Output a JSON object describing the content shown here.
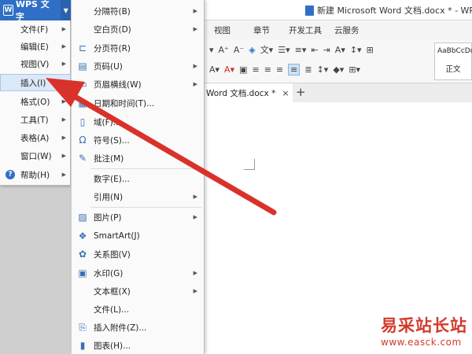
{
  "app": {
    "title_label": "WPS 文字",
    "window_title": "新建 Microsoft Word 文档.docx * - WPS 文",
    "logo_letter": "W"
  },
  "ribbon": {
    "tabs": [
      "视图",
      "章节",
      "开发工具",
      "云服务"
    ],
    "style_preview": "AaBbCcDd",
    "style_name": "正文"
  },
  "document_tab": {
    "label": "Word 文档.docx *",
    "close": "×",
    "new_tab": "+"
  },
  "main_menu": {
    "items": [
      {
        "label": "文件(F)",
        "has_submenu": true
      },
      {
        "label": "编辑(E)",
        "has_submenu": true
      },
      {
        "label": "视图(V)",
        "has_submenu": true
      },
      {
        "label": "插入(I)",
        "has_submenu": true,
        "active": true
      },
      {
        "label": "格式(O)",
        "has_submenu": true
      },
      {
        "label": "工具(T)",
        "has_submenu": true
      },
      {
        "label": "表格(A)",
        "has_submenu": true
      },
      {
        "label": "窗口(W)",
        "has_submenu": true
      },
      {
        "label": "帮助(H)",
        "has_submenu": true,
        "icon": "help-icon",
        "icon_glyph": "?"
      }
    ]
  },
  "insert_menu": {
    "items": [
      {
        "label": "分隔符(B)",
        "has_submenu": true,
        "icon": ""
      },
      {
        "label": "空白页(D)",
        "has_submenu": true,
        "icon": ""
      },
      {
        "label": "分页符(R)",
        "has_submenu": false,
        "icon": "page-break-icon"
      },
      {
        "label": "页码(U)",
        "has_submenu": true,
        "icon": "page-number-icon"
      },
      {
        "label": "页眉横线(W)",
        "has_submenu": true,
        "icon": "header-line-icon"
      },
      {
        "label": "日期和时间(T)...",
        "has_submenu": false,
        "icon": "date-time-icon"
      },
      {
        "label": "域(F)...",
        "has_submenu": false,
        "icon": "field-icon"
      },
      {
        "label": "符号(S)...",
        "has_submenu": false,
        "icon": "symbol-icon"
      },
      {
        "label": "批注(M)",
        "has_submenu": false,
        "icon": "comment-icon"
      },
      {
        "label": "数字(E)...",
        "has_submenu": false,
        "icon": ""
      },
      {
        "label": "引用(N)",
        "has_submenu": true,
        "icon": ""
      },
      {
        "label": "图片(P)",
        "has_submenu": true,
        "icon": "picture-icon"
      },
      {
        "label": "SmartArt(J)",
        "has_submenu": false,
        "icon": "smartart-icon"
      },
      {
        "label": "关系图(V)",
        "has_submenu": false,
        "icon": "relation-diagram-icon"
      },
      {
        "label": "水印(G)",
        "has_submenu": true,
        "icon": "watermark-icon"
      },
      {
        "label": "文本框(X)",
        "has_submenu": true,
        "icon": ""
      },
      {
        "label": "文件(L)...",
        "has_submenu": false,
        "icon": ""
      },
      {
        "label": "插入附件(Z)...",
        "has_submenu": false,
        "icon": "attachment-icon"
      },
      {
        "label": "图表(H)...",
        "has_submenu": false,
        "icon": "chart-icon"
      }
    ]
  },
  "watermark_text": "易采站长站",
  "watermark_url": "www.easck.com",
  "colors": {
    "accent": "#2f6fc6",
    "arrow": "#d9322b",
    "highlight": "#dbe8f8"
  }
}
